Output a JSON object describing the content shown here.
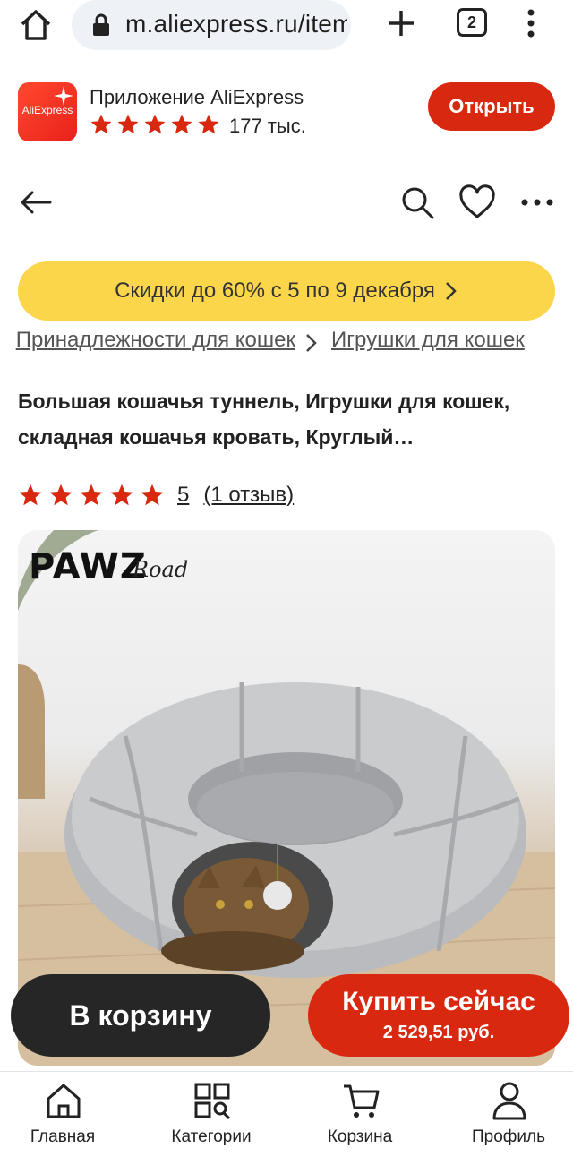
{
  "browser": {
    "url": "m.aliexpress.ru/item",
    "tab_count": "2",
    "icons": [
      "home-icon",
      "lock-icon",
      "plus-icon",
      "tabs-icon",
      "kebab-menu-icon"
    ]
  },
  "app_banner": {
    "logo_text": "AliExpress",
    "app_name": "Приложение AliExpress",
    "stars": 5,
    "rating_count": "177 тыс.",
    "open_label": "Открыть"
  },
  "header": {
    "icons": [
      "back-arrow-icon",
      "search-icon",
      "heart-icon",
      "more-icon"
    ]
  },
  "promo": {
    "text": "Скидки до 60% с 5 по 9 декабря"
  },
  "breadcrumb": {
    "items": [
      "Принадлежности для кошек",
      "Игрушки для кошек"
    ]
  },
  "product": {
    "title": "Большая кошачья туннель, Игрушки для кошек, складная кошачья кровать, Круглый…",
    "rating_value": "5",
    "reviews_label": "(1 отзыв)",
    "stars": 5,
    "brand": "PAWZ",
    "brand_sub": "Road"
  },
  "actions": {
    "cart_label": "В корзину",
    "buy_label": "Купить сейчас",
    "buy_price": "2 529,51 руб."
  },
  "bottom_nav": {
    "items": [
      {
        "label": "Главная",
        "icon": "home-outline-icon"
      },
      {
        "label": "Категории",
        "icon": "categories-icon"
      },
      {
        "label": "Корзина",
        "icon": "cart-icon"
      },
      {
        "label": "Профиль",
        "icon": "profile-icon"
      }
    ]
  },
  "colors": {
    "accent_red": "#d8280f",
    "promo_yellow": "#fbd54a",
    "dark_button": "#262626"
  }
}
